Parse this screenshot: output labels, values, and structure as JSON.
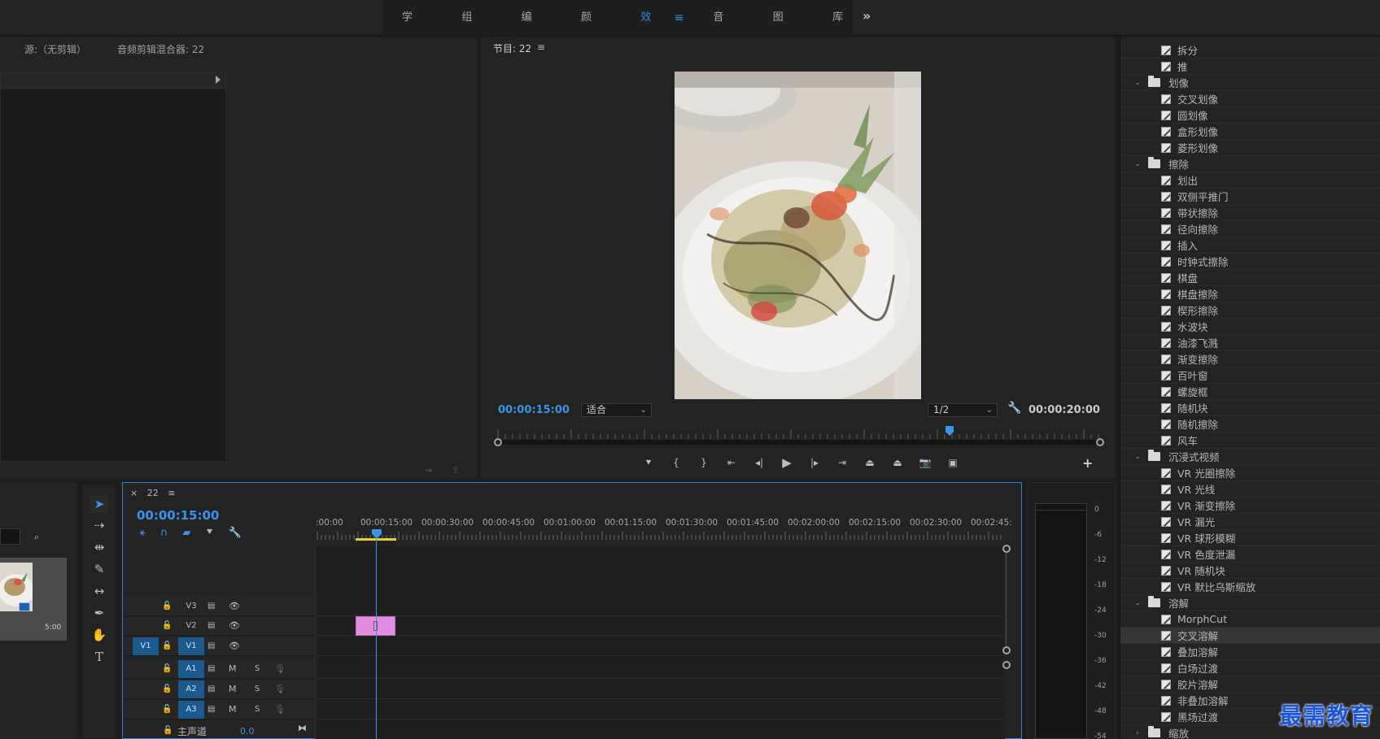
{
  "workspace_tabs": [
    "学习",
    "组件",
    "编辑",
    "颜色",
    "效果",
    "音频",
    "图形",
    "库"
  ],
  "workspace_active": "效果",
  "workspace_menu_glyph": "≡",
  "workspace_more": "»",
  "source_panel": {
    "tab_source": "源:（无剪辑）",
    "tab_mixer": "音频剪辑混合器: 22"
  },
  "program_panel": {
    "title": "节目: 22",
    "menu_glyph": "≡",
    "timecode_current": "00:00:15:00",
    "fit": "适合",
    "resolution": "1/2",
    "timecode_duration": "00:00:20:00",
    "playhead_fraction": 0.75
  },
  "timeline": {
    "close_glyph": "×",
    "sequence_name": "22",
    "menu_glyph": "≡",
    "timecode": "00:00:15:00",
    "ruler_labels": [
      ":00:00",
      "00:00:15:00",
      "00:00:30:00",
      "00:00:45:00",
      "00:01:00:00",
      "00:01:15:00",
      "00:01:30:00",
      "00:01:45:00",
      "00:02:00:00",
      "00:02:15:00",
      "00:02:30:00",
      "00:02:45:"
    ],
    "tracks_video": [
      {
        "name": "V3",
        "source": "",
        "targeted": false
      },
      {
        "name": "V2",
        "source": "",
        "targeted": false
      },
      {
        "name": "V1",
        "source": "V1",
        "targeted": true
      }
    ],
    "tracks_audio": [
      {
        "name": "A1",
        "m": "M",
        "s": "S"
      },
      {
        "name": "A2",
        "m": "M",
        "s": "S"
      },
      {
        "name": "A3",
        "m": "M",
        "s": "S"
      }
    ],
    "master_label": "主声道",
    "master_value": "0.0"
  },
  "project": {
    "thumb_duration": "5:00"
  },
  "meter": {
    "scale": [
      "0",
      "-6",
      "-12",
      "-18",
      "-24",
      "-30",
      "-36",
      "-42",
      "-48",
      "-54"
    ]
  },
  "effects": [
    {
      "type": "item",
      "label": "拆分"
    },
    {
      "type": "item",
      "label": "推"
    },
    {
      "type": "folder",
      "label": "划像",
      "expanded": true
    },
    {
      "type": "item",
      "label": "交叉划像"
    },
    {
      "type": "item",
      "label": "圆划像"
    },
    {
      "type": "item",
      "label": "盒形划像"
    },
    {
      "type": "item",
      "label": "菱形划像"
    },
    {
      "type": "folder",
      "label": "擦除",
      "expanded": true
    },
    {
      "type": "item",
      "label": "划出"
    },
    {
      "type": "item",
      "label": "双侧平推门"
    },
    {
      "type": "item",
      "label": "带状擦除"
    },
    {
      "type": "item",
      "label": "径向擦除"
    },
    {
      "type": "item",
      "label": "插入"
    },
    {
      "type": "item",
      "label": "时钟式擦除"
    },
    {
      "type": "item",
      "label": "棋盘"
    },
    {
      "type": "item",
      "label": "棋盘擦除"
    },
    {
      "type": "item",
      "label": "楔形擦除"
    },
    {
      "type": "item",
      "label": "水波块"
    },
    {
      "type": "item",
      "label": "油漆飞溅"
    },
    {
      "type": "item",
      "label": "渐变擦除"
    },
    {
      "type": "item",
      "label": "百叶窗"
    },
    {
      "type": "item",
      "label": "螺旋框"
    },
    {
      "type": "item",
      "label": "随机块"
    },
    {
      "type": "item",
      "label": "随机擦除"
    },
    {
      "type": "item",
      "label": "风车"
    },
    {
      "type": "folder",
      "label": "沉浸式视频",
      "expanded": true
    },
    {
      "type": "item",
      "label": "VR 光圈擦除"
    },
    {
      "type": "item",
      "label": "VR 光线"
    },
    {
      "type": "item",
      "label": "VR 渐变擦除"
    },
    {
      "type": "item",
      "label": "VR 漏光"
    },
    {
      "type": "item",
      "label": "VR 球形模糊"
    },
    {
      "type": "item",
      "label": "VR 色度泄漏"
    },
    {
      "type": "item",
      "label": "VR 随机块"
    },
    {
      "type": "item",
      "label": "VR 默比乌斯缩放"
    },
    {
      "type": "folder",
      "label": "溶解",
      "expanded": true
    },
    {
      "type": "item",
      "label": "MorphCut"
    },
    {
      "type": "item",
      "label": "交叉溶解",
      "selected": true
    },
    {
      "type": "item",
      "label": "叠加溶解"
    },
    {
      "type": "item",
      "label": "白场过渡"
    },
    {
      "type": "item",
      "label": "胶片溶解"
    },
    {
      "type": "item",
      "label": "非叠加溶解"
    },
    {
      "type": "item",
      "label": "黑场过渡"
    },
    {
      "type": "folder",
      "label": "缩放",
      "expanded": false
    }
  ],
  "watermark": "最需教育",
  "colors": {
    "accent": "#2f8ee8",
    "panel": "#232323",
    "clip": "#e08ee0",
    "workbar": "#e1d12a"
  }
}
